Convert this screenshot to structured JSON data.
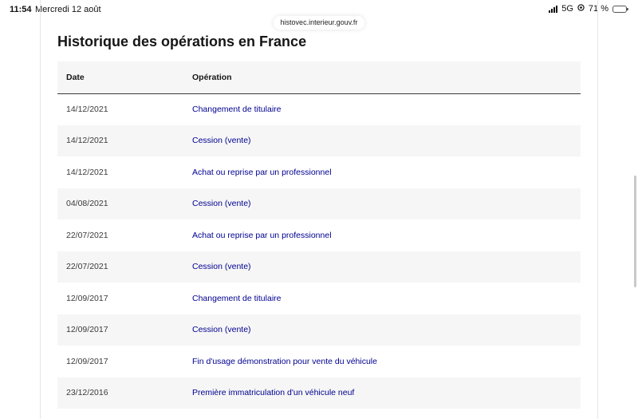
{
  "status_bar": {
    "time": "11:54",
    "date": "Mercredi 12 août",
    "network": "5G",
    "battery_text": "71 %",
    "battery_level": 0.71
  },
  "browser": {
    "url": "histovec.interieur.gouv.fr"
  },
  "page": {
    "title": "Historique des opérations en France"
  },
  "table": {
    "headers": {
      "date": "Date",
      "operation": "Opération"
    },
    "rows": [
      {
        "date": "14/12/2021",
        "operation": "Changement de titulaire"
      },
      {
        "date": "14/12/2021",
        "operation": "Cession (vente)"
      },
      {
        "date": "14/12/2021",
        "operation": "Achat ou reprise par un professionnel"
      },
      {
        "date": "04/08/2021",
        "operation": "Cession (vente)"
      },
      {
        "date": "22/07/2021",
        "operation": "Achat ou reprise par un professionnel"
      },
      {
        "date": "22/07/2021",
        "operation": "Cession (vente)"
      },
      {
        "date": "12/09/2017",
        "operation": "Changement de titulaire"
      },
      {
        "date": "12/09/2017",
        "operation": "Cession (vente)"
      },
      {
        "date": "12/09/2017",
        "operation": "Fin d'usage démonstration pour vente du véhicule"
      },
      {
        "date": "23/12/2016",
        "operation": "Première immatriculation d'un véhicule neuf"
      }
    ]
  },
  "colors": {
    "link": "#000091",
    "row_alt": "#f6f6f6",
    "text": "#161616"
  },
  "icons": {
    "signal": "cellular-signal-icon",
    "location": "location-icon",
    "battery": "battery-icon"
  }
}
